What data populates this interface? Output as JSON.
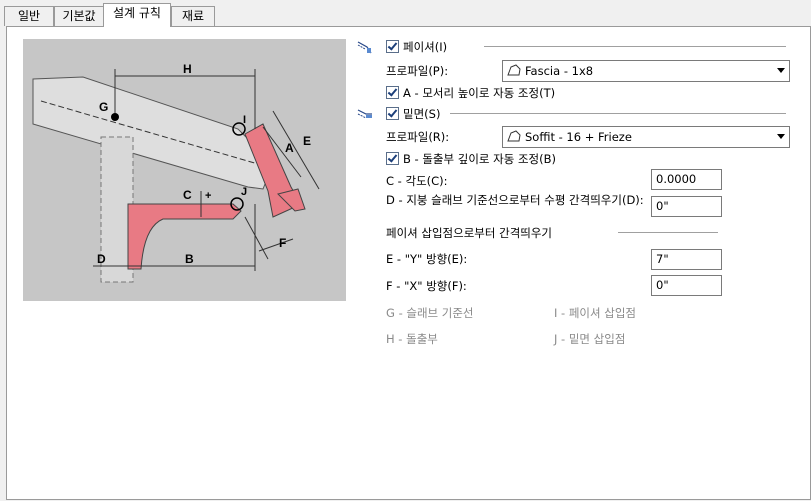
{
  "tabs": [
    {
      "label": "일반"
    },
    {
      "label": "기본값"
    },
    {
      "label": "설계 규칙"
    },
    {
      "label": "재료"
    }
  ],
  "diagram": {
    "labels": {
      "H": "H",
      "G": "G",
      "I": "I",
      "A": "A",
      "E": "E",
      "C": "C",
      "J": "J",
      "F": "F",
      "D": "D",
      "B": "B",
      "plus": "+"
    },
    "colors": {
      "background": "#c6c6c6",
      "member": "#e87a84"
    }
  },
  "fascia": {
    "checkbox_label": "페이셔(I)",
    "profile_label": "프로파일(P):",
    "profile_value": "Fascia - 1x8",
    "auto_adjust_label": "A - 모서리 높이로 자동 조정(T)",
    "icon": "fascia-icon"
  },
  "soffit": {
    "checkbox_label": "밑면(S)",
    "profile_label": "프로파일(R):",
    "profile_value": "Soffit - 16 + Frieze",
    "auto_adjust_label": "B - 돌출부 깊이로 자동 조정(B)",
    "icon": "soffit-icon"
  },
  "fields": {
    "angle_label": "C - 각도(C):",
    "angle_value": "0.0000",
    "offset_label": "D - 지붕 슬래브 기준선으로부터 수평 간격띄우기(D):",
    "offset_value": "0\"",
    "insert_header": "페이셔 삽입점으로부터 간격띄우기",
    "y_label": "E - \"Y\" 방향(E):",
    "y_value": "7\"",
    "x_label": "F - \"X\" 방향(F):",
    "x_value": "0\""
  },
  "legend": {
    "g": "G - 슬래브 기준선",
    "i": "I - 페이셔 삽입점",
    "h": "H - 돌출부",
    "j": "J - 밑면 삽입점"
  }
}
